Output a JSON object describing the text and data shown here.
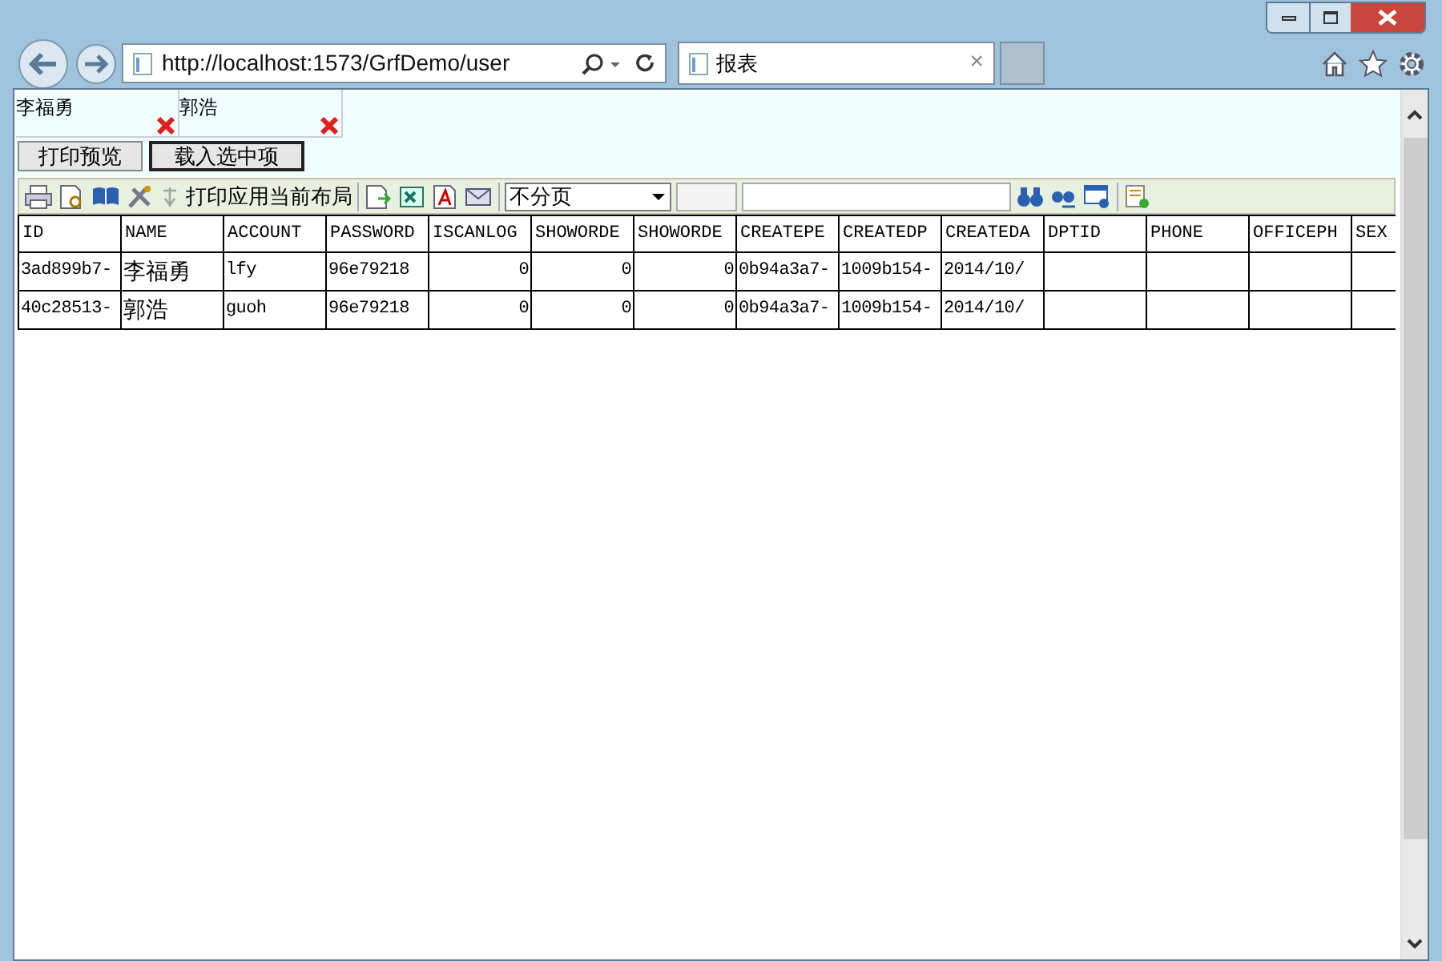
{
  "browser": {
    "address": "http://localhost:1573/GrfDemo/user",
    "tab": {
      "title": "报表",
      "close": "×"
    }
  },
  "chips": [
    {
      "label": "李福勇"
    },
    {
      "label": "郭浩"
    }
  ],
  "buttons": [
    {
      "label": "打印预览",
      "focused": false
    },
    {
      "label": "载入选中项",
      "focused": true
    }
  ],
  "toolbar": {
    "apply_layout": "打印应用当前布局",
    "paging": "不分页"
  },
  "table": {
    "columns": [
      "ID",
      "NAME",
      "ACCOUNT",
      "PASSWORD",
      "ISCANLOG",
      "SHOWORDE",
      "SHOWORDE",
      "CREATEPE",
      "CREATEDP",
      "CREATEDA",
      "DPTID",
      "PHONE",
      "OFFICEPH",
      "SEX"
    ],
    "rows": [
      {
        "cells": [
          "3ad899b7-",
          "李福勇",
          "lfy",
          "96e79218",
          "0",
          "0",
          "0",
          "0b94a3a7-",
          "1009b154-",
          "2014/10/",
          "",
          "",
          "",
          ""
        ]
      },
      {
        "cells": [
          "40c28513-",
          "郭浩",
          "guoh",
          "96e79218",
          "0",
          "0",
          "0",
          "0b94a3a7-",
          "1009b154-",
          "2014/10/",
          "",
          "",
          "",
          ""
        ]
      }
    ]
  }
}
